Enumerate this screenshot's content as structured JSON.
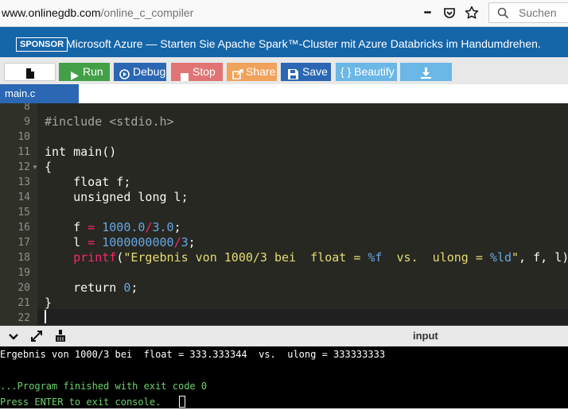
{
  "browser": {
    "url_host": "www.onlinegdb.com",
    "url_path": "/online_c_compiler",
    "search_placeholder": "Suchen",
    "more_label": "•••"
  },
  "sponsor": {
    "badge": "SPONSOR",
    "text": "Microsoft Azure — Starten Sie Apache Spark™-Cluster mit Azure Databricks im Handumdrehen."
  },
  "toolbar": {
    "run": "Run",
    "debug": "Debug",
    "stop": "Stop",
    "share": "Share",
    "save": "Save",
    "beautify": "{ } Beautify"
  },
  "file_tab": "main.c",
  "editor": {
    "line_numbers": [
      "8",
      "9",
      "10",
      "11",
      "12",
      "13",
      "14",
      "15",
      "16",
      "17",
      "18",
      "19",
      "20",
      "21",
      "22"
    ],
    "code": {
      "l9_include": "#include <stdio.h>",
      "l11": "int main()",
      "l12": "{",
      "l13": "    float f;",
      "l14": "    unsigned long l;",
      "l16_a": "    f ",
      "l16_eq": "=",
      "l16_v1": " 1000.0",
      "l16_div": "/",
      "l16_v2": "3.0",
      "l16_end": ";",
      "l17_a": "    l ",
      "l17_eq": "=",
      "l17_v1": " 1000000000",
      "l17_div": "/",
      "l17_v2": "3",
      "l17_end": ";",
      "l18_ind": "    ",
      "l18_fn": "printf",
      "l18_p": "(",
      "l18_s1": "\"Ergebnis von 1000/3 bei  float = ",
      "l18_f1": "%f",
      "l18_s2": "  vs.  ulong = ",
      "l18_f2": "%ld",
      "l18_s3": "\"",
      "l18_rest": ", f, l);",
      "l20_a": "    return ",
      "l20_v": "0",
      "l20_end": ";",
      "l21": "}"
    }
  },
  "console": {
    "input_label": "input",
    "output_line": "Ergebnis von 1000/3 bei  float = 333.333344  vs.  ulong = 333333333",
    "finish_line": "...Program finished with exit code 0",
    "prompt_line": "Press ENTER to exit console."
  },
  "colors": {
    "brand_blue": "#2b67b2",
    "run_green": "#43a047",
    "stop_red": "#e07474",
    "share_orange": "#f0a35a",
    "beautify_blue": "#6bb7e6",
    "editor_bg": "#272822"
  }
}
